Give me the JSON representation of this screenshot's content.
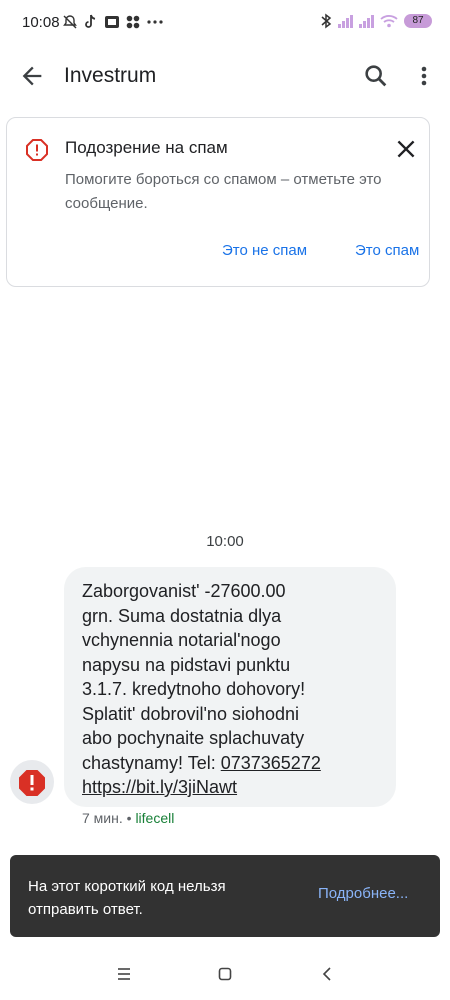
{
  "status_bar": {
    "time": "10:08",
    "left_icons": [
      "muted-bell-icon",
      "tiktok-icon",
      "sim-card-icon",
      "grid-icon",
      "more-dots-icon"
    ],
    "right_icons": [
      "bluetooth-icon",
      "signal-icon",
      "signal-icon",
      "wifi-icon"
    ],
    "battery": "87"
  },
  "app_bar": {
    "title": "Investrum"
  },
  "spam_card": {
    "title": "Подозрение на спам",
    "description": "Помогите бороться со спамом – отметьте это сообщение.",
    "not_spam_label": "Это не спам",
    "spam_label": "Это спам",
    "accent_color": "#1a73e8",
    "warning_color": "#d93025"
  },
  "conversation": {
    "time": "10:00",
    "message": {
      "text": "Zaborgovanist' -27600.00\ngrn. Suma dostatnia dlya\nvchynennia notarial'nogo\nnapysu na pidstavi punktu\n3.1.7. kredytnoho dohovory!\nSplatit' dobrovil'no siohodni\nabo pochynaite splachuvaty\nchastynamy! Tel: ",
      "phone": "0737365272",
      "link": "https://bit.ly/3jiNawt"
    },
    "meta_age": "7 мин.",
    "meta_separator": "•",
    "meta_sim": "lifecell"
  },
  "snackbar": {
    "text": "На этот короткий код нельзя отправить ответ.",
    "action": "Подробнее..."
  }
}
